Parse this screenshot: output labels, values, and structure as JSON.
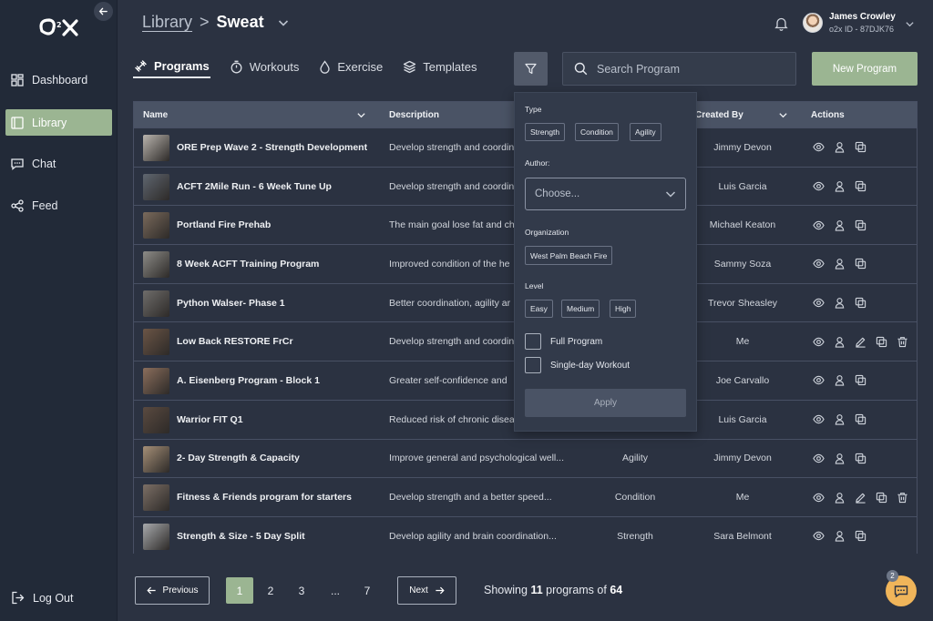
{
  "brand": {
    "logo_text": "O2X",
    "accent": "#9bb592"
  },
  "sidebar": {
    "items": [
      {
        "label": "Dashboard",
        "icon": "dashboard-icon"
      },
      {
        "label": "Library",
        "icon": "library-icon",
        "active": true
      },
      {
        "label": "Chat",
        "icon": "chat-icon"
      },
      {
        "label": "Feed",
        "icon": "share-icon"
      }
    ],
    "logout": "Log Out"
  },
  "header": {
    "breadcrumb_parent": "Library",
    "breadcrumb_sep": ">",
    "breadcrumb_current": "Sweat",
    "user": {
      "name": "James Crowley",
      "id": "o2x ID - 87DJK76"
    }
  },
  "tabs": [
    {
      "label": "Programs",
      "icon": "dumbbell-icon",
      "active": true
    },
    {
      "label": "Workouts",
      "icon": "stopwatch-icon"
    },
    {
      "label": "Exercise",
      "icon": "drop-icon"
    },
    {
      "label": "Templates",
      "icon": "layers-icon"
    }
  ],
  "search": {
    "placeholder": "Search Program"
  },
  "new_program_label": "New Program",
  "table": {
    "columns": {
      "name": "Name",
      "description": "Description",
      "created_by": "Created By",
      "actions": "Actions"
    },
    "rows": [
      {
        "name": "ORE Prep Wave 2 - Strength Development",
        "description": "Develop strength and coordin",
        "level": "",
        "created_by": "Jimmy Devon",
        "editable": false,
        "thumb": "#b9b4ae"
      },
      {
        "name": "ACFT 2Mile Run - 6 Week Tune Up",
        "description": "Develop strength and coordin",
        "level": "",
        "created_by": "Luis Garcia",
        "editable": false,
        "thumb": "#5f6670"
      },
      {
        "name": "Portland Fire Prehab",
        "description": "The main goal lose fat and ch",
        "level": "",
        "created_by": "Michael Keaton",
        "editable": false,
        "thumb": "#7a6a5c"
      },
      {
        "name": "8 Week ACFT Training Program",
        "description": "Improved condition of the he",
        "level": "",
        "created_by": "Sammy Soza",
        "editable": false,
        "thumb": "#8d8c88"
      },
      {
        "name": "Python Walser- Phase 1",
        "description": "Better coordination, agility ar",
        "level": "",
        "created_by": "Trevor Sheasley",
        "editable": false,
        "thumb": "#6f6d6b"
      },
      {
        "name": "Low Back RESTORE FrCr",
        "description": "Develop strength and coordin",
        "level": "",
        "created_by": "Me",
        "editable": true,
        "thumb": "#6b5546"
      },
      {
        "name": "A. Eisenberg Program - Block 1",
        "description": "Greater self-confidence and",
        "level": "",
        "created_by": "Joe Carvallo",
        "editable": false,
        "thumb": "#8b6e5c"
      },
      {
        "name": "Warrior FIT Q1",
        "description": "Reduced risk of chronic disea",
        "level": "",
        "created_by": "Luis Garcia",
        "editable": false,
        "thumb": "#5a4a40"
      },
      {
        "name": "2- Day Strength & Capacity",
        "description": "Improve general and psychological well...",
        "level": "Agility",
        "created_by": "Jimmy Devon",
        "editable": false,
        "thumb": "#a58f77"
      },
      {
        "name": "Fitness & Friends program for starters",
        "description": "Develop strength and a better speed...",
        "level": "Condition",
        "created_by": "Me",
        "editable": true,
        "thumb": "#7c6f66"
      },
      {
        "name": "Strength & Size - 5 Day Split",
        "description": "Develop agility and brain coordination...",
        "level": "Strength",
        "created_by": "Sara Belmont",
        "editable": false,
        "thumb": "#a7a9ac"
      }
    ]
  },
  "filter": {
    "type_label": "Type",
    "types": [
      "Strength",
      "Condition",
      "Agility"
    ],
    "author_label": "Author:",
    "author_placeholder": "Choose...",
    "org_label": "Organization",
    "orgs": [
      "West Palm Beach Fire"
    ],
    "level_label": "Level",
    "levels": [
      "Easy",
      "Medium",
      "High"
    ],
    "full_program": "Full Program",
    "single_day": "Single-day Workout",
    "apply": "Apply"
  },
  "pagination": {
    "previous": "Previous",
    "next": "Next",
    "pages": [
      "1",
      "2",
      "3",
      "...",
      "7"
    ],
    "current": "1",
    "showing_prefix": "Showing",
    "showing_count": "11",
    "showing_middle": "programs of",
    "showing_total": "64"
  },
  "chat_badge": "2"
}
